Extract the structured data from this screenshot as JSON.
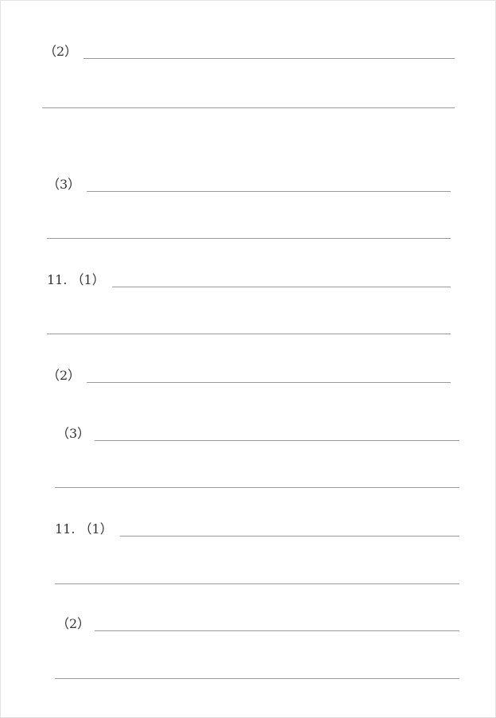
{
  "answer_sheet": {
    "rows": [
      {
        "label": "（2）"
      },
      {
        "label": "（3）"
      },
      {
        "label": "11. （1）"
      },
      {
        "label": "（2）"
      },
      {
        "label": "（3）"
      },
      {
        "label": "11. （1）"
      },
      {
        "label": "（2）"
      }
    ]
  }
}
